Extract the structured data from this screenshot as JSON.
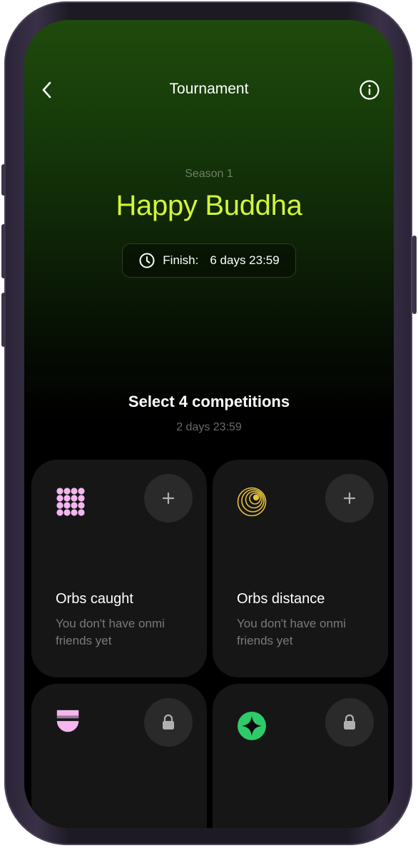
{
  "header": {
    "title": "Tournament"
  },
  "tournament": {
    "season": "Season 1",
    "name": "Happy Buddha",
    "finish_label": "Finish:",
    "finish_value": "6 days 23:59"
  },
  "selection": {
    "title": "Select 4 competitions",
    "timer": "2 days 23:59"
  },
  "competitions": [
    {
      "title": "Orbs caught",
      "description": "You don't have onmi friends yet",
      "action": "plus-icon",
      "icon": "dot-grid-icon",
      "icon_color": "#f4b6f0"
    },
    {
      "title": "Orbs distance",
      "description": "You don't have onmi friends yet",
      "action": "plus-icon",
      "icon": "concentric-rings-icon",
      "icon_color": "#e7c23a"
    },
    {
      "title": "",
      "description": "",
      "action": "lock-icon",
      "icon": "half-circle-icon",
      "icon_color": "#f4b6f0"
    },
    {
      "title": "",
      "description": "",
      "action": "lock-icon",
      "icon": "sparkle-badge-icon",
      "icon_color": "#2ecb6a"
    }
  ],
  "colors": {
    "accent": "#d4f53b",
    "background": "#000000",
    "card": "#161616"
  }
}
